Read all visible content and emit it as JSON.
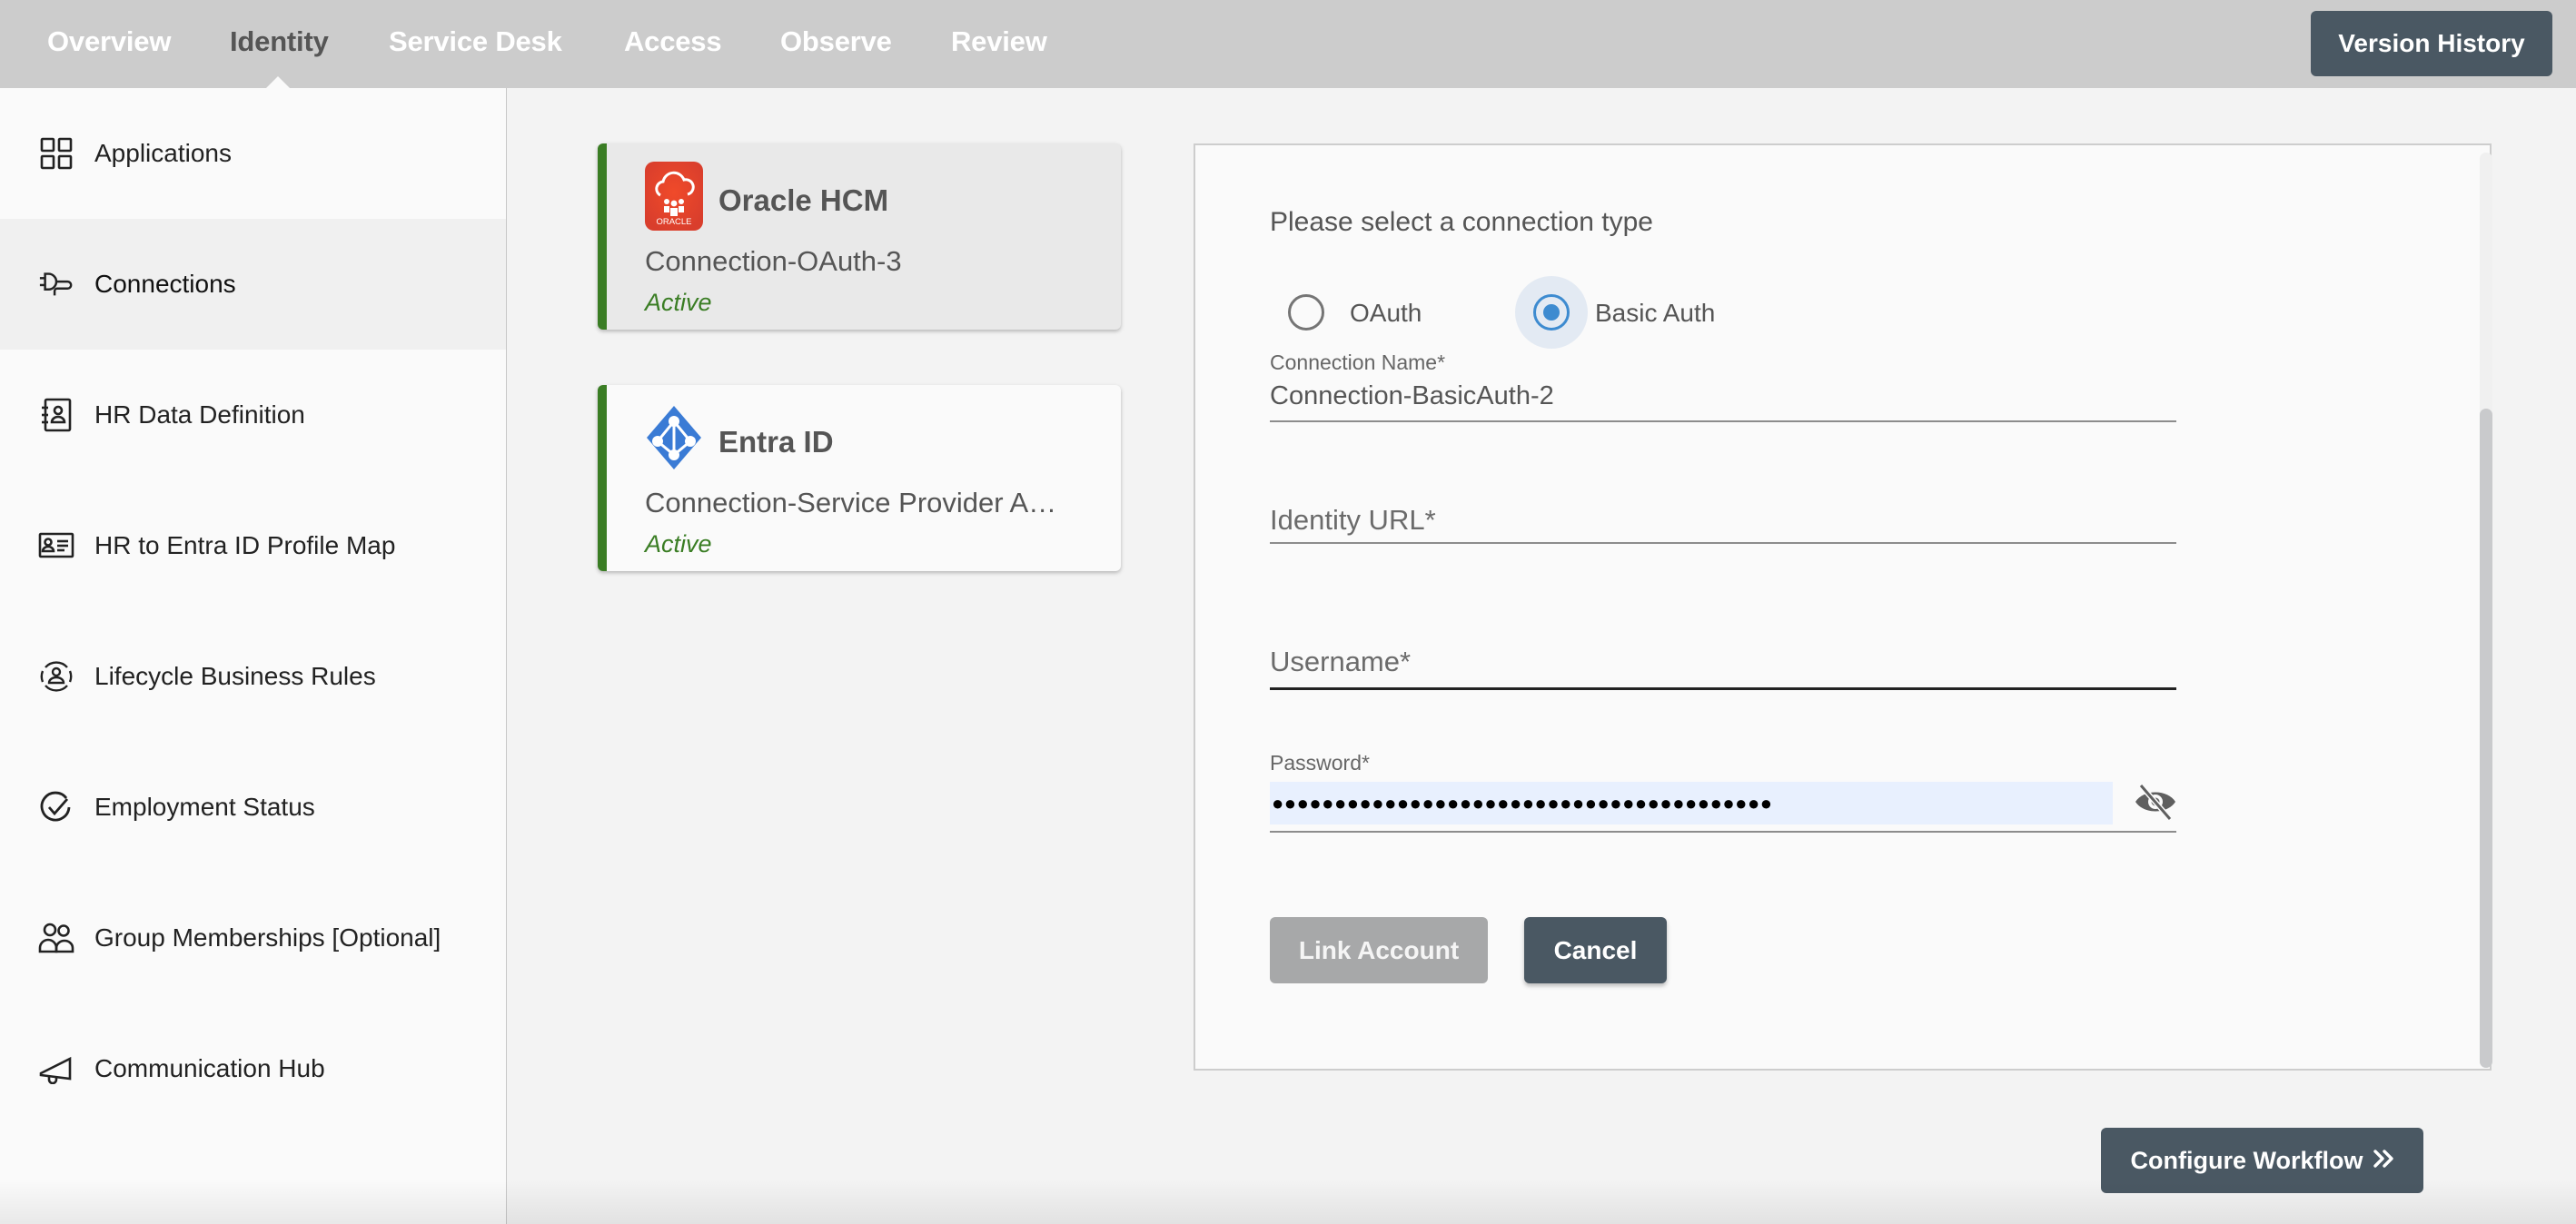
{
  "topnav": {
    "tabs": [
      {
        "label": "Overview",
        "active": false
      },
      {
        "label": "Identity",
        "active": true
      },
      {
        "label": "Service Desk",
        "active": false
      },
      {
        "label": "Access",
        "active": false
      },
      {
        "label": "Observe",
        "active": false
      },
      {
        "label": "Review",
        "active": false
      }
    ],
    "version_history_label": "Version History"
  },
  "sidebar": {
    "items": [
      {
        "label": "Applications",
        "icon": "grid-icon",
        "active": false
      },
      {
        "label": "Connections",
        "icon": "plug-icon",
        "active": true
      },
      {
        "label": "HR Data Definition",
        "icon": "contact-book-icon",
        "active": false
      },
      {
        "label": "HR to Entra ID Profile Map",
        "icon": "id-card-icon",
        "active": false
      },
      {
        "label": "Lifecycle Business Rules",
        "icon": "user-cycle-icon",
        "active": false
      },
      {
        "label": "Employment Status",
        "icon": "check-circle-icon",
        "active": false
      },
      {
        "label": "Group Memberships [Optional]",
        "icon": "group-icon",
        "active": false
      },
      {
        "label": "Communication Hub",
        "icon": "megaphone-icon",
        "active": false
      }
    ]
  },
  "connections": [
    {
      "title": "Oracle HCM",
      "connection": "Connection-OAuth-3",
      "status": "Active",
      "logo": "oracle-logo",
      "logo_text": "ORACLE",
      "selected": true
    },
    {
      "title": "Entra ID",
      "connection": "Connection-Service Provider A…",
      "status": "Active",
      "logo": "entra-id-logo",
      "selected": false
    }
  ],
  "form": {
    "title": "Please select a connection type",
    "connection_types": [
      {
        "label": "OAuth",
        "checked": false
      },
      {
        "label": "Basic Auth",
        "checked": true
      }
    ],
    "connection_name": {
      "label": "Connection Name*",
      "value": "Connection-BasicAuth-2"
    },
    "identity_url": {
      "placeholder": "Identity URL*",
      "value": ""
    },
    "username": {
      "placeholder": "Username*",
      "value": ""
    },
    "password": {
      "label": "Password*",
      "masked_value": "●●●●●●●●●●●●●●●●●●●●●●●●●●●●●●●●●●●●●●●●",
      "visibility_icon": "eye-off-icon"
    },
    "link_account_label": "Link Account",
    "cancel_label": "Cancel",
    "scroll_position": 0.72
  },
  "footer": {
    "configure_workflow_label": "Configure Workflow",
    "configure_workflow_icon": "double-chevron-right-icon"
  },
  "colors": {
    "accent_dark": "#4a5863",
    "active_green": "#3a7d24",
    "radio_blue": "#3d8bd0",
    "oracle_red": "#e8442c",
    "entra_blue": "#3a7bd5"
  }
}
